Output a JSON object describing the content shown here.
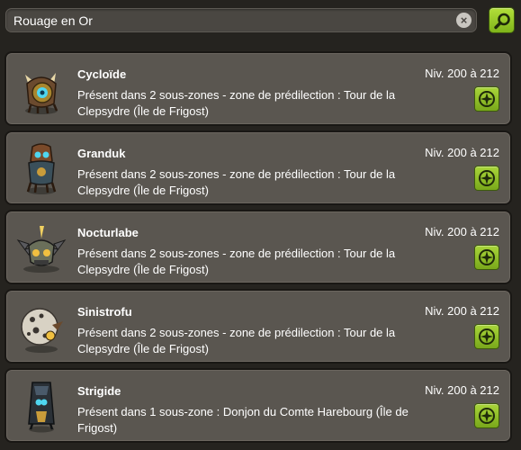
{
  "search": {
    "value": "Rouage en Or",
    "clear_icon": "close-circle-icon",
    "search_icon": "magnifier-icon",
    "accent_color": "#9ccc2c"
  },
  "results": [
    {
      "name": "Cycloïde",
      "level": "Niv. 200 à 212",
      "description": "Présent dans 2 sous-zones - zone de prédilection : Tour de la Clepsydre (Île de Frigost)",
      "avatar_icon": "clockwork-cyclops-monster-icon",
      "locate_icon": "compass-icon"
    },
    {
      "name": "Granduk",
      "level": "Niv. 200 à 212",
      "description": "Présent dans 2 sous-zones - zone de prédilection : Tour de la Clepsydre (Île de Frigost)",
      "avatar_icon": "clockwork-warrior-monster-icon",
      "locate_icon": "compass-icon"
    },
    {
      "name": "Nocturlabe",
      "level": "Niv. 200 à 212",
      "description": "Présent dans 2 sous-zones - zone de prédilection : Tour de la Clepsydre (Île de Frigost)",
      "avatar_icon": "clockwork-bat-monster-icon",
      "locate_icon": "compass-icon"
    },
    {
      "name": "Sinistrofu",
      "level": "Niv. 200 à 212",
      "description": "Présent dans 2 sous-zones - zone de prédilection : Tour de la Clepsydre (Île de Frigost)",
      "avatar_icon": "spotted-egg-monster-icon",
      "locate_icon": "compass-icon"
    },
    {
      "name": "Strigide",
      "level": "Niv. 200 à 212",
      "description": "Présent dans 1 sous-zone : Donjon du Comte Harebourg (Île de Frigost)",
      "avatar_icon": "hooded-owl-monster-icon",
      "locate_icon": "compass-icon"
    }
  ]
}
